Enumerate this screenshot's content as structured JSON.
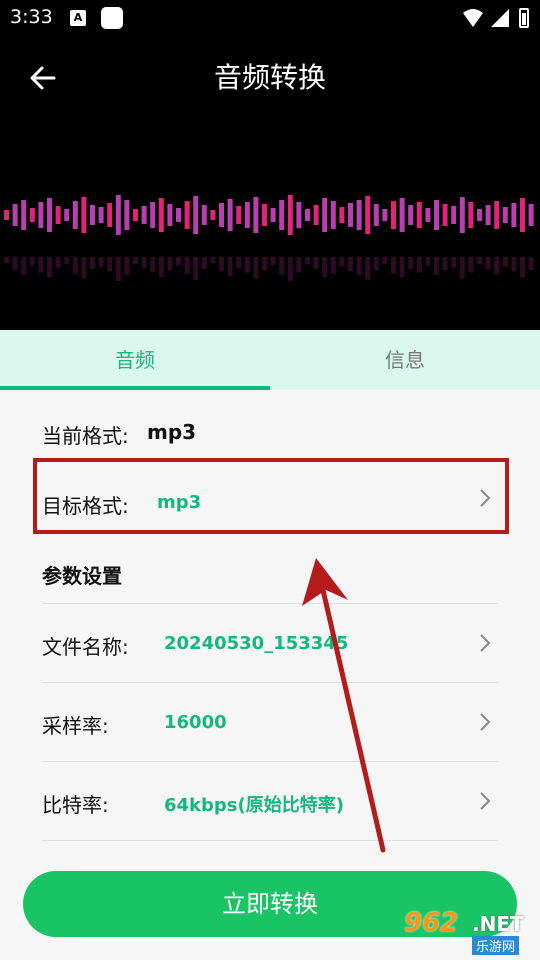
{
  "status_bar": {
    "time": "3:33",
    "notif_icon_letter": "A"
  },
  "header": {
    "title": "音频转换",
    "back_icon": "arrow-left-icon"
  },
  "tabs": [
    {
      "label": "音频",
      "active": true
    },
    {
      "label": "信息",
      "active": false
    }
  ],
  "current_format": {
    "label": "当前格式:",
    "value": "mp3"
  },
  "target_format": {
    "label": "目标格式:",
    "value": "mp3"
  },
  "params": {
    "section_title": "参数设置",
    "rows": [
      {
        "label": "文件名称:",
        "value": "20240530_153345"
      },
      {
        "label": "采样率:",
        "value": "16000"
      },
      {
        "label": "比特率:",
        "value": "64kbps(原始比特率)"
      }
    ]
  },
  "convert_button": {
    "label": "立即转换"
  },
  "watermark": {
    "number": "962",
    "net": ".NET",
    "text": "乐游网"
  },
  "colors": {
    "accent": "#14b87a",
    "button": "#18c464",
    "highlight": "#b41c1c",
    "tab_bg": "#dbf8ee"
  }
}
